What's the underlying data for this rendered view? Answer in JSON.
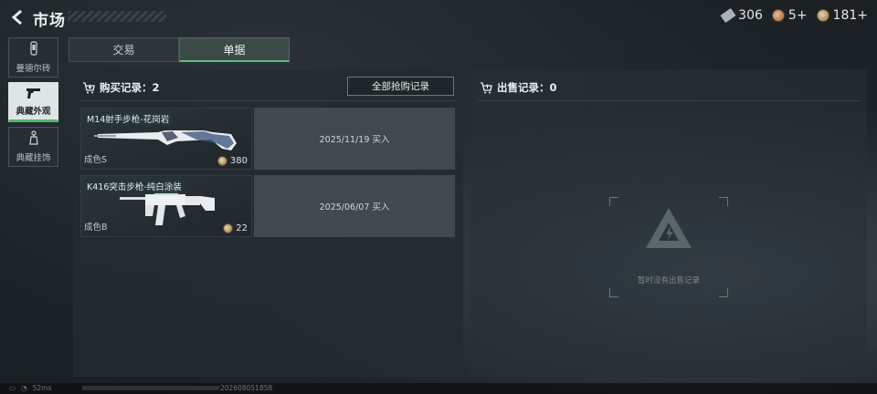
{
  "header": {
    "title": "市场",
    "currencies": [
      {
        "icon": "ticket-icon",
        "value": "306"
      },
      {
        "icon": "medal-coin-icon",
        "value": "5+"
      },
      {
        "icon": "gold-coin-icon",
        "value": "181+"
      }
    ]
  },
  "sidebar": {
    "items": [
      {
        "label": "曼德尔砖",
        "icon": "brick-icon",
        "active": false
      },
      {
        "label": "典藏外观",
        "icon": "pistol-icon",
        "active": true
      },
      {
        "label": "典藏挂饰",
        "icon": "charm-icon",
        "active": false
      }
    ]
  },
  "tabs": [
    {
      "label": "交易",
      "active": false
    },
    {
      "label": "单据",
      "active": true
    }
  ],
  "purchase": {
    "header": "购买记录：2",
    "all_button": "全部抢购记录",
    "records": [
      {
        "name": "M14射手步枪-花岗岩",
        "grade": "成色S",
        "price": "380",
        "date": "2025/11/19 买入"
      },
      {
        "name": "K416突击步枪-纯白涂装",
        "grade": "成色B",
        "price": "22",
        "date": "2025/06/07 买入"
      }
    ]
  },
  "sales": {
    "header": "出售记录：0",
    "empty_text": "暂时没有出售记录"
  },
  "statusbar": {
    "ping": "52ms",
    "build": "202608051858"
  },
  "colors": {
    "accent_green": "#4fb86a",
    "panel_bg": "#242b30"
  }
}
